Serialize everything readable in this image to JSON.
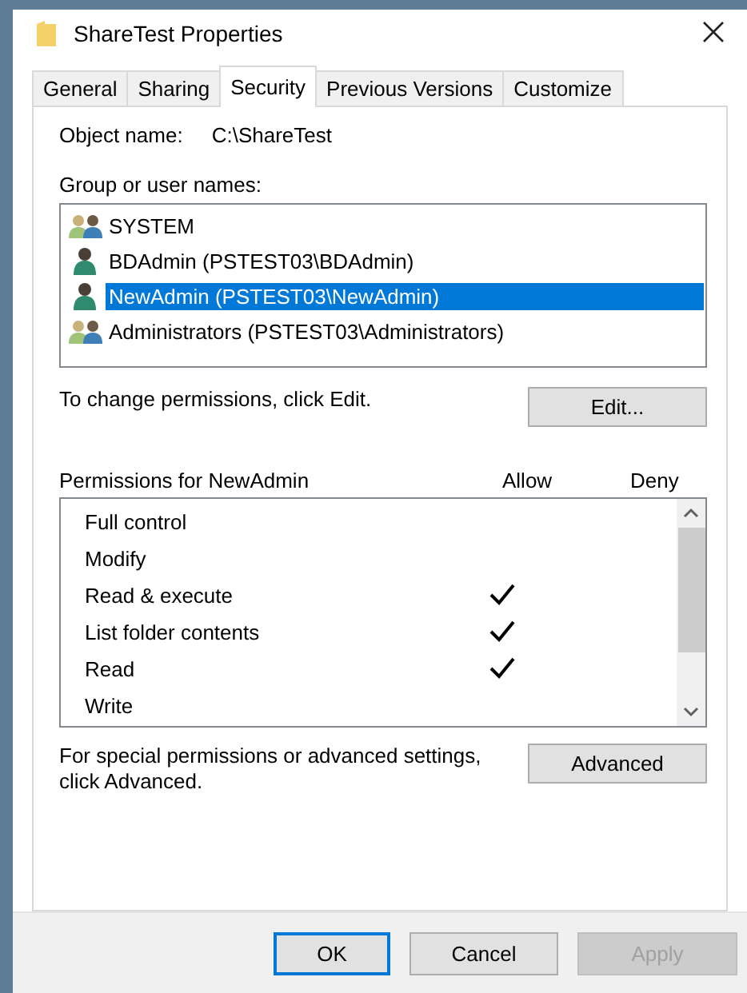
{
  "window": {
    "title": "ShareTest Properties"
  },
  "tabs": [
    {
      "label": "General",
      "selected": false
    },
    {
      "label": "Sharing",
      "selected": false
    },
    {
      "label": "Security",
      "selected": true
    },
    {
      "label": "Previous Versions",
      "selected": false
    },
    {
      "label": "Customize",
      "selected": false
    }
  ],
  "object_name": {
    "label": "Object name:",
    "value": "C:\\ShareTest"
  },
  "group_label": "Group or user names:",
  "users": [
    {
      "name": "SYSTEM",
      "kind": "group",
      "selected": false
    },
    {
      "name": "BDAdmin (PSTEST03\\BDAdmin)",
      "kind": "user",
      "selected": false
    },
    {
      "name": "NewAdmin (PSTEST03\\NewAdmin)",
      "kind": "user",
      "selected": true
    },
    {
      "name": "Administrators (PSTEST03\\Administrators)",
      "kind": "group",
      "selected": false
    }
  ],
  "edit_hint": "To change permissions, click Edit.",
  "edit_button": "Edit...",
  "permissions": {
    "title": "Permissions for NewAdmin",
    "allow_header": "Allow",
    "deny_header": "Deny",
    "rows": [
      {
        "name": "Full control",
        "allow": false,
        "deny": false
      },
      {
        "name": "Modify",
        "allow": false,
        "deny": false
      },
      {
        "name": "Read & execute",
        "allow": true,
        "deny": false
      },
      {
        "name": "List folder contents",
        "allow": true,
        "deny": false
      },
      {
        "name": "Read",
        "allow": true,
        "deny": false
      },
      {
        "name": "Write",
        "allow": false,
        "deny": false
      }
    ]
  },
  "advanced_hint": "For special permissions or advanced settings, click Advanced.",
  "advanced_button": "Advanced",
  "buttons": [
    {
      "label": "OK",
      "default": true,
      "disabled": false
    },
    {
      "label": "Cancel",
      "default": false,
      "disabled": false
    },
    {
      "label": "Apply",
      "default": false,
      "disabled": true
    }
  ]
}
